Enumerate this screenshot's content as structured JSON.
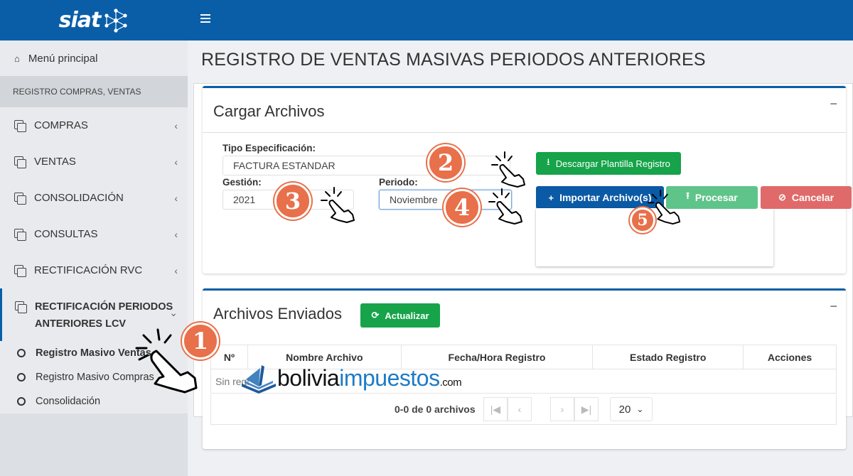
{
  "brand": {
    "name": "siat"
  },
  "sidebar": {
    "main_menu": "Menú principal",
    "section_header": "REGISTRO COMPRAS, VENTAS",
    "items": [
      {
        "label": "COMPRAS"
      },
      {
        "label": "VENTAS"
      },
      {
        "label": "CONSOLIDACIÓN"
      },
      {
        "label": "CONSULTAS"
      },
      {
        "label": "RECTIFICACIÓN RVC"
      }
    ],
    "active_item": {
      "line1": "RECTIFICACIÓN PERIODOS",
      "line2": "ANTERIORES LCV"
    },
    "sub_items": [
      {
        "label": "Registro Masivo Ventas"
      },
      {
        "label": "Registro Masivo Compras"
      },
      {
        "label": "Consolidación"
      }
    ]
  },
  "page": {
    "title": "REGISTRO DE VENTAS MASIVAS PERIODOS ANTERIORES"
  },
  "upload_card": {
    "title": "Cargar Archivos",
    "collapse_symbol": "−",
    "tipo_label": "Tipo Especificación:",
    "tipo_value": "FACTURA ESTANDAR",
    "gestion_label": "Gestión:",
    "gestion_value": "2021",
    "periodo_label": "Periodo:",
    "periodo_value": "Noviembre",
    "download_button": "Descargar Plantilla Registro",
    "import_button": "Importar Archivo(s)",
    "process_button": "Procesar",
    "cancel_button": "Cancelar"
  },
  "sent_card": {
    "title": "Archivos Enviados",
    "collapse_symbol": "−",
    "refresh_button": "Actualizar",
    "columns": [
      "Nº",
      "Nombre Archivo",
      "Fecha/Hora Registro",
      "Estado Registro",
      "Acciones"
    ],
    "empty_text": "Sin regi",
    "pager_text": "0-0 de 0 archivos",
    "page_size": "20"
  },
  "annotations": {
    "steps": [
      "1",
      "2",
      "3",
      "4",
      "5"
    ]
  },
  "watermark": {
    "part1": "bolivia",
    "part2": "impuestos",
    "domain": ".com"
  },
  "colors": {
    "primary": "#0a5ea8",
    "success": "#16a34a",
    "danger": "#e06a6a",
    "badge": "#e8704a"
  }
}
